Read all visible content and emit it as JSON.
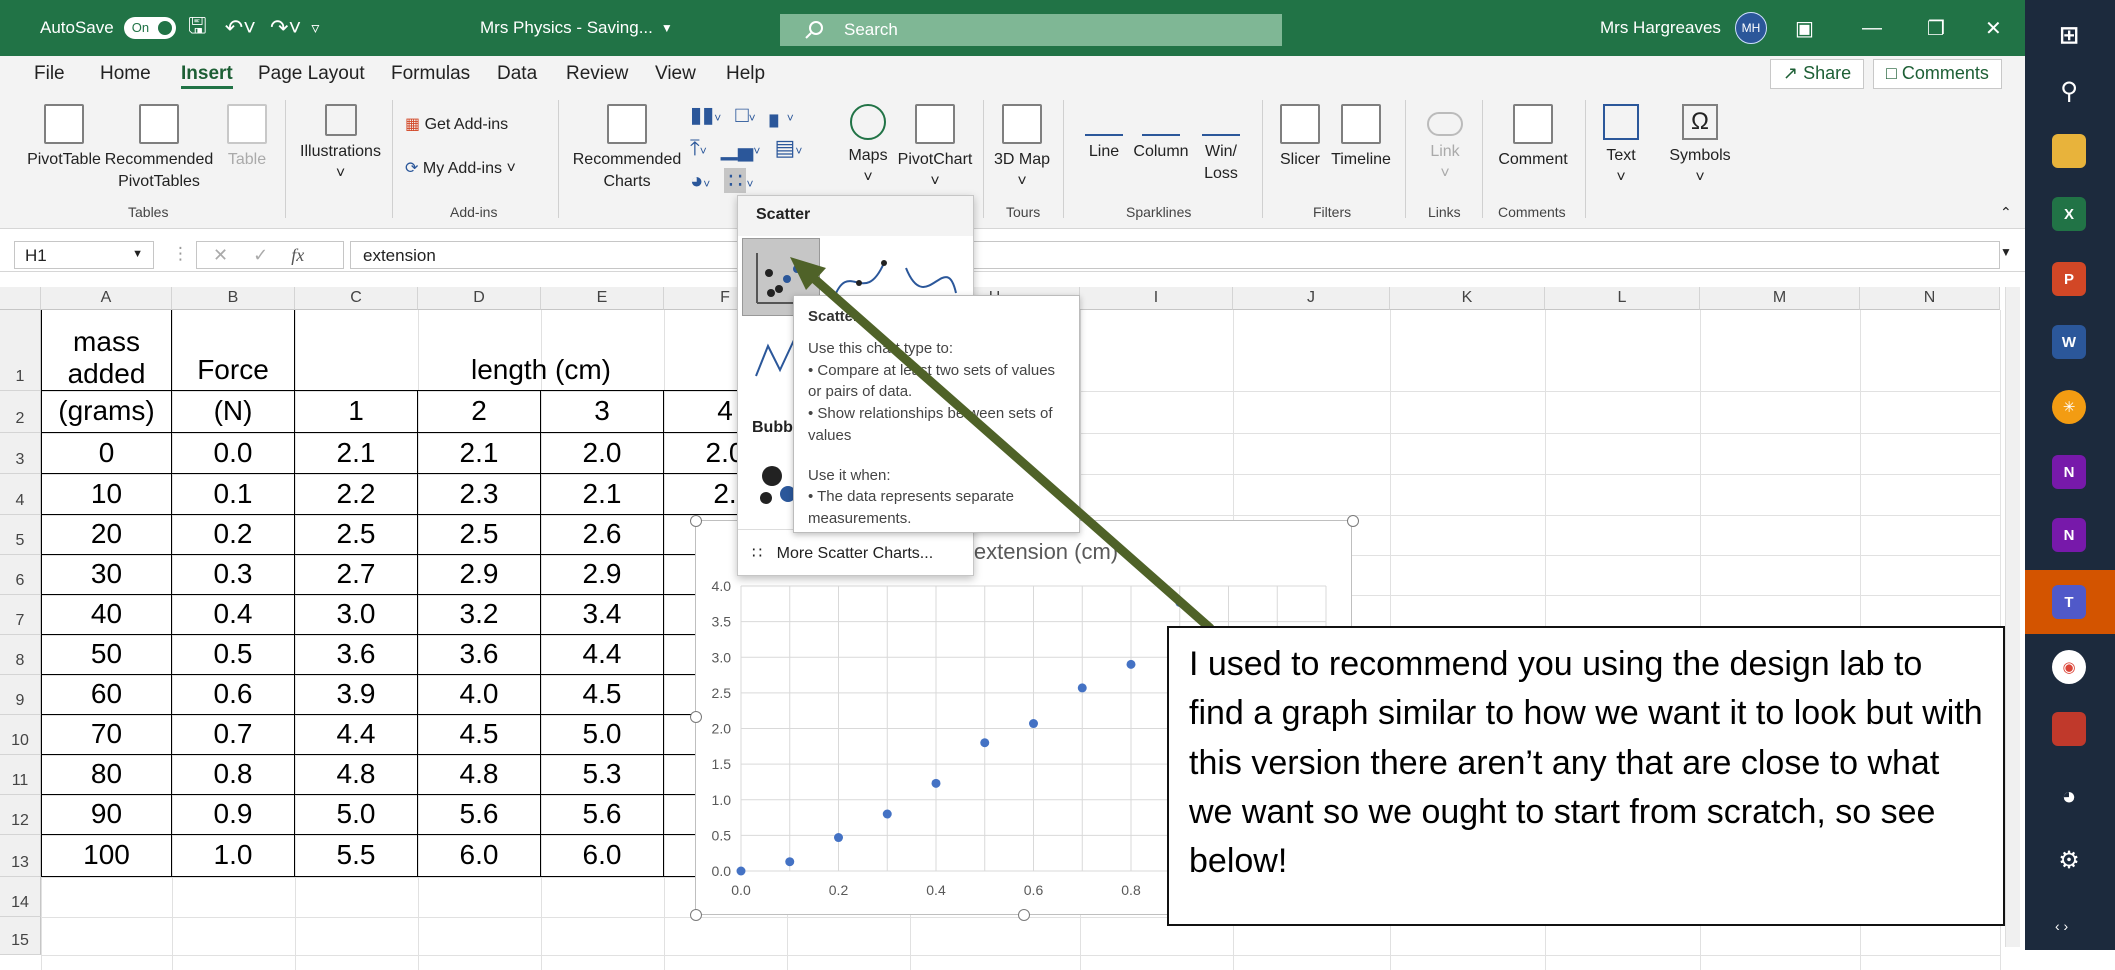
{
  "titlebar": {
    "autosave_label": "AutoSave",
    "autosave_state": "On",
    "doc_title": "Mrs Physics - Saving...",
    "search_placeholder": "Search",
    "user_name": "Mrs Hargreaves",
    "user_initials": "MH"
  },
  "menu": {
    "items": [
      "File",
      "Home",
      "Insert",
      "Page Layout",
      "Formulas",
      "Data",
      "Review",
      "View",
      "Help"
    ],
    "active": "Insert",
    "share": "Share",
    "comments": "Comments"
  },
  "ribbon": {
    "pivot_table": "PivotTable",
    "recommended_pivot": "Recommended PivotTables",
    "table": "Table",
    "illustrations": "Illustrations",
    "get_addins": "Get Add-ins",
    "my_addins": "My Add-ins",
    "recommended_charts": "Recommended Charts",
    "maps": "Maps",
    "pivot_chart": "PivotChart",
    "map3d": "3D Map",
    "line": "Line",
    "column": "Column",
    "winloss": "Win/ Loss",
    "slicer": "Slicer",
    "timeline": "Timeline",
    "link": "Link",
    "comment": "Comment",
    "text": "Text",
    "symbols": "Symbols",
    "groups": {
      "tables": "Tables",
      "addins": "Add-ins",
      "tours": "Tours",
      "sparklines": "Sparklines",
      "filters": "Filters",
      "links": "Links",
      "comments": "Comments"
    }
  },
  "formula_bar": {
    "name_box": "H1",
    "fx": "fx",
    "content": "extension"
  },
  "columns": [
    "A",
    "B",
    "C",
    "D",
    "E",
    "F",
    "G",
    "H",
    "I",
    "J",
    "K",
    "L",
    "M",
    "N"
  ],
  "rows": [
    "1",
    "2",
    "3",
    "4",
    "5",
    "6",
    "7",
    "8",
    "9",
    "10",
    "11",
    "12",
    "13",
    "14",
    "15"
  ],
  "sheet": {
    "header_a1": "mass\nadded",
    "header_a2": "(grams)",
    "header_b1": "Force",
    "header_b2": "(N)",
    "header_length": "length (cm)",
    "trial_nums": [
      "1",
      "2",
      "3",
      "4"
    ],
    "data": [
      [
        "0",
        "0.0",
        "2.1",
        "2.1",
        "2.0",
        "2.0"
      ],
      [
        "10",
        "0.1",
        "2.2",
        "2.3",
        "2.1",
        "2."
      ],
      [
        "20",
        "0.2",
        "2.5",
        "2.5",
        "2.6",
        ""
      ],
      [
        "30",
        "0.3",
        "2.7",
        "2.9",
        "2.9",
        ""
      ],
      [
        "40",
        "0.4",
        "3.0",
        "3.2",
        "3.4",
        ""
      ],
      [
        "50",
        "0.5",
        "3.6",
        "3.6",
        "4.4",
        ""
      ],
      [
        "60",
        "0.6",
        "3.9",
        "4.0",
        "4.5",
        ""
      ],
      [
        "70",
        "0.7",
        "4.4",
        "4.5",
        "5.0",
        ""
      ],
      [
        "80",
        "0.8",
        "4.8",
        "4.8",
        "5.3",
        ""
      ],
      [
        "90",
        "0.9",
        "5.0",
        "5.6",
        "5.6",
        ""
      ],
      [
        "100",
        "1.0",
        "5.5",
        "6.0",
        "6.0",
        ""
      ]
    ]
  },
  "dropdown": {
    "scatter_title": "Scatter",
    "bubble_title": "Bubb",
    "more": "More Scatter Charts..."
  },
  "tooltip": {
    "title": "Scatter",
    "line1": "Use this chart type to:",
    "line2": "• Compare at least two sets of values or pairs of data.",
    "line3": "• Show relationships between sets of values",
    "line4": "Use it when:",
    "line5": "• The data represents separate measurements."
  },
  "chart_data": {
    "type": "scatter",
    "title": "extension (cm)",
    "x": [
      0.0,
      0.1,
      0.2,
      0.3,
      0.4,
      0.5,
      0.6,
      0.7,
      0.8,
      0.9
    ],
    "y": [
      0.0,
      0.13,
      0.47,
      0.8,
      1.23,
      1.8,
      2.07,
      2.57,
      2.9,
      3.77
    ],
    "xlim": [
      0.0,
      1.2
    ],
    "ylim": [
      0.0,
      4.0
    ],
    "xticks": [
      "0.0",
      "0.2",
      "0.4",
      "0.6",
      "0.8"
    ],
    "yticks": [
      "0.0",
      "0.5",
      "1.0",
      "1.5",
      "2.0",
      "2.5",
      "3.0",
      "3.5",
      "4.0"
    ],
    "grid": true,
    "color": "#4472c4"
  },
  "callout": {
    "text": "I used to recommend you using the design lab to find a graph similar to how we want it to look but with this version there aren’t any that are close to what we want so we ought to start from scratch, so see below!"
  },
  "colors": {
    "excel_green": "#217346",
    "arrow": "#4f6228",
    "taskbar": "#1c2a3d"
  }
}
